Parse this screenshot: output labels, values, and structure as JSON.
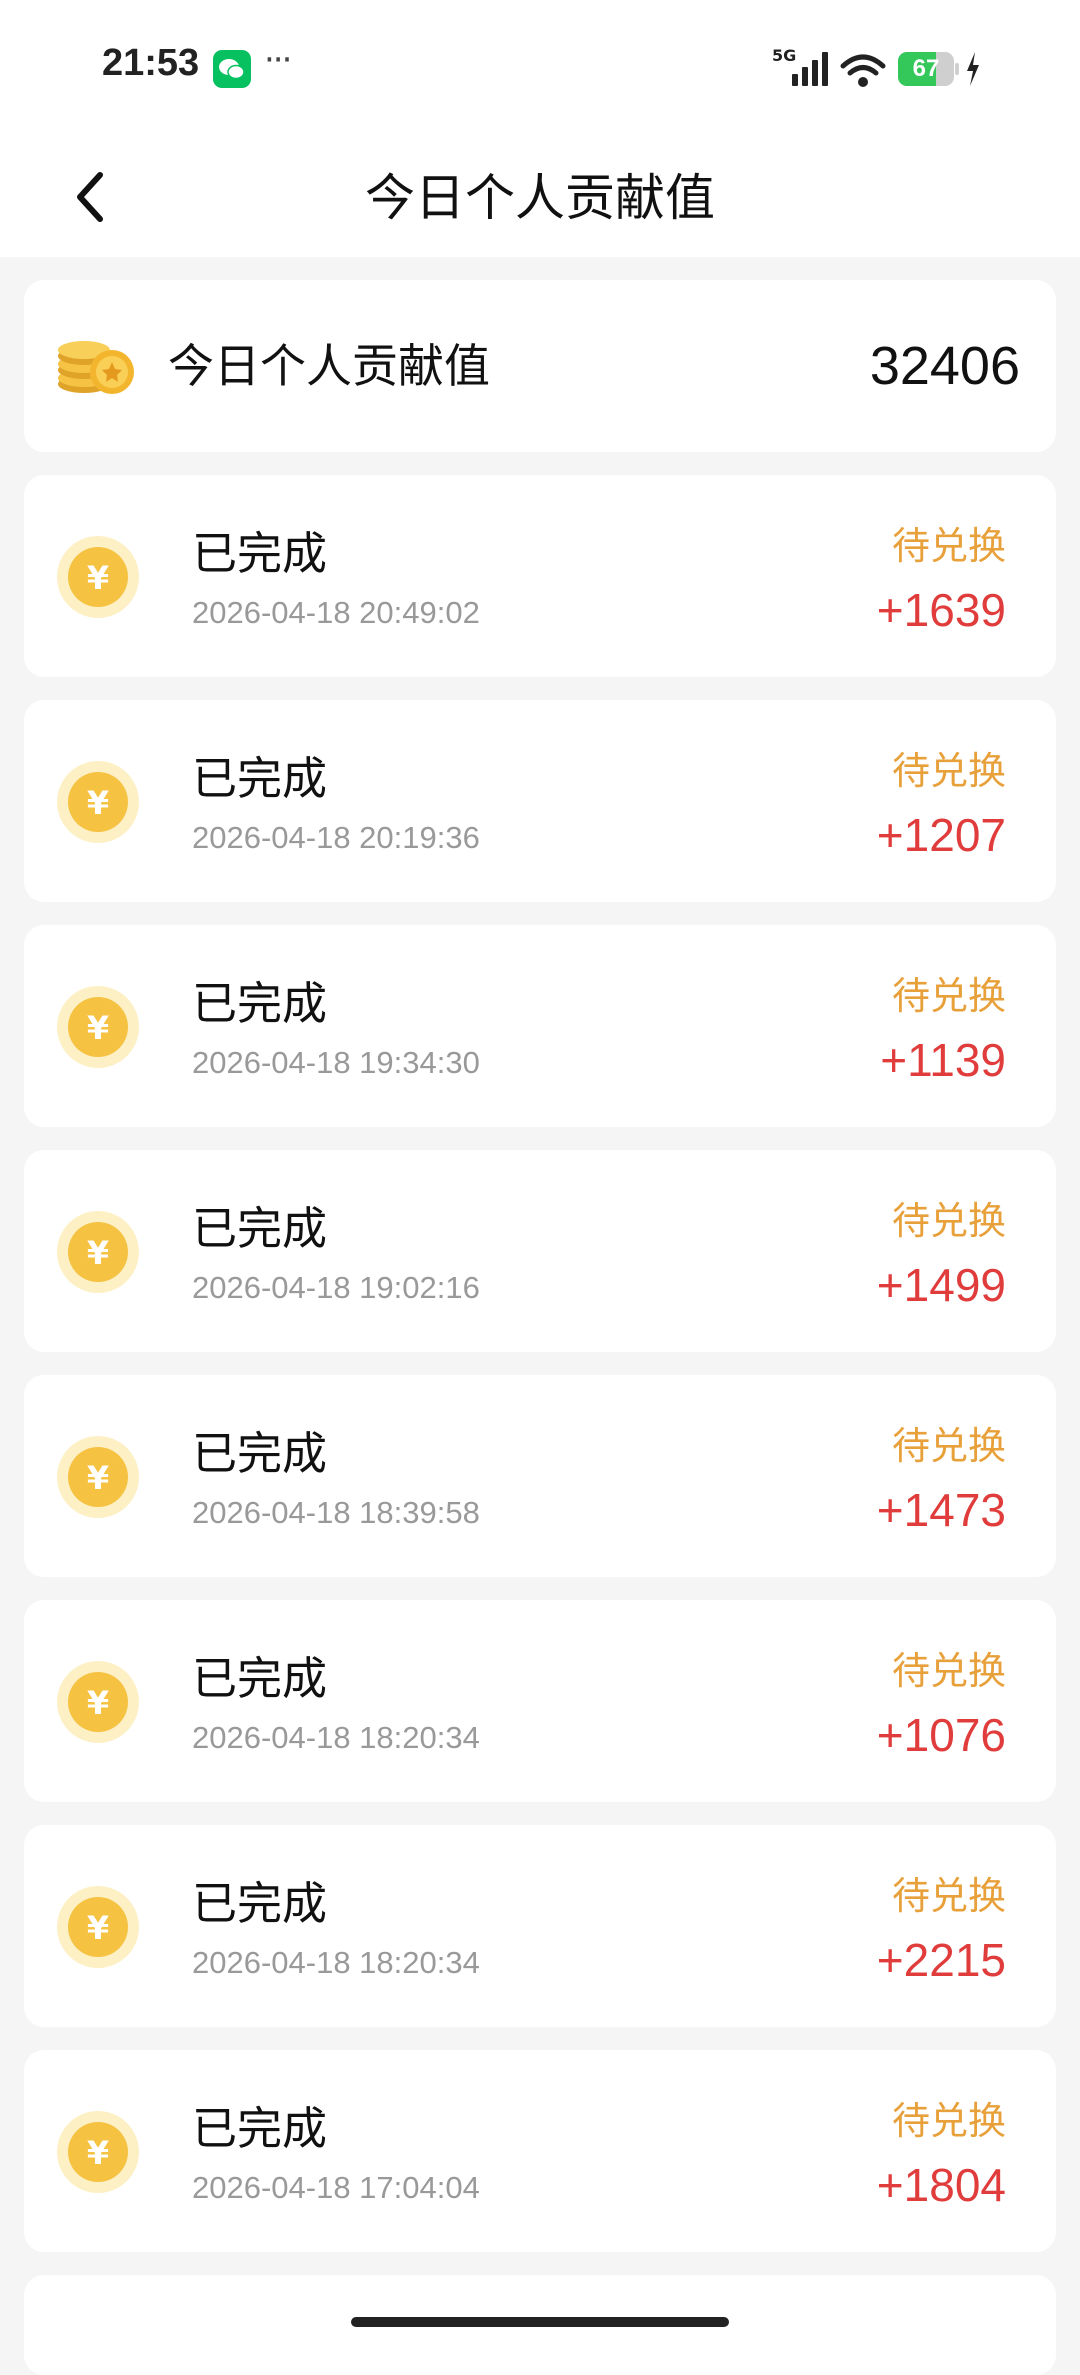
{
  "status_bar": {
    "time": "21:53",
    "more": "···",
    "network": "5G",
    "battery": "67",
    "battery_level": 0.67,
    "icons": [
      "wechat-icon",
      "signal-icon",
      "wifi-icon",
      "battery-icon",
      "charging-icon"
    ]
  },
  "nav": {
    "title": "今日个人贡献值",
    "back_icon": "chevron-left-icon"
  },
  "summary": {
    "label": "今日个人贡献值",
    "value": "32406",
    "icon": "gold-coins-icon"
  },
  "records": [
    {
      "status": "已完成",
      "time": "2026-04-18 20:49:02",
      "tag": "待兑换",
      "amount": "+1639"
    },
    {
      "status": "已完成",
      "time": "2026-04-18 20:19:36",
      "tag": "待兑换",
      "amount": "+1207"
    },
    {
      "status": "已完成",
      "time": "2026-04-18 19:34:30",
      "tag": "待兑换",
      "amount": "+1139"
    },
    {
      "status": "已完成",
      "time": "2026-04-18 19:02:16",
      "tag": "待兑换",
      "amount": "+1499"
    },
    {
      "status": "已完成",
      "time": "2026-04-18 18:39:58",
      "tag": "待兑换",
      "amount": "+1473"
    },
    {
      "status": "已完成",
      "time": "2026-04-18 18:20:34",
      "tag": "待兑换",
      "amount": "+1076"
    },
    {
      "status": "已完成",
      "time": "2026-04-18 18:20:34",
      "tag": "待兑换",
      "amount": "+2215"
    },
    {
      "status": "已完成",
      "time": "2026-04-18 17:04:04",
      "tag": "待兑换",
      "amount": "+1804"
    }
  ],
  "colors": {
    "tag": "#e8a03a",
    "amount": "#e03c3c",
    "coin": "#f5c242",
    "battery": "#34c759",
    "wechat": "#07c160"
  }
}
